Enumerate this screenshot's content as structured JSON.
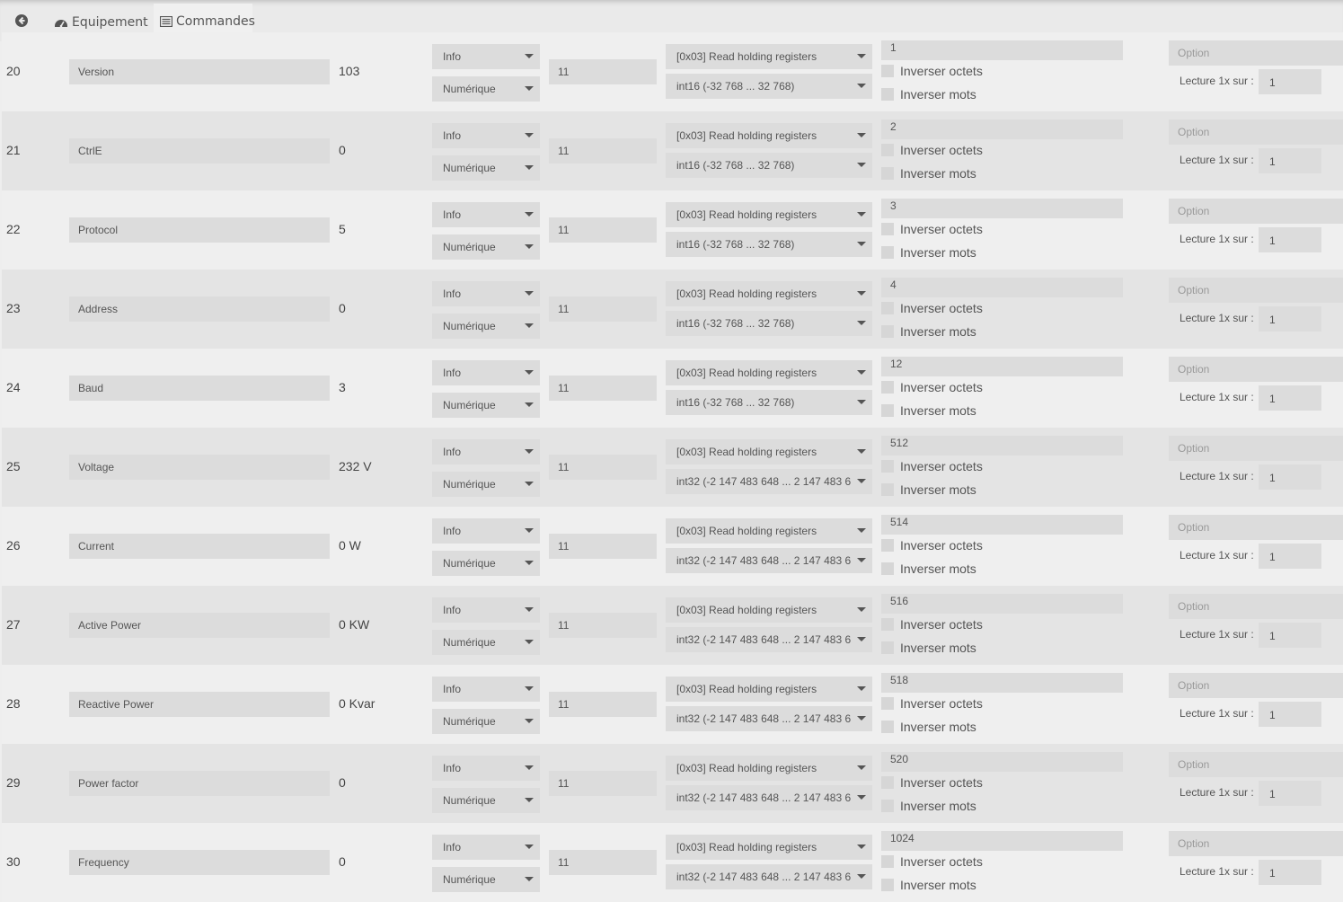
{
  "tabs": {
    "equipement": "Equipement",
    "commandes": "Commandes"
  },
  "common": {
    "type": "Info",
    "subtype": "Numérique",
    "slave": "11",
    "function": "[0x03] Read holding registers",
    "invert_bytes": "Inverser octets",
    "invert_words": "Inverser mots",
    "option_placeholder": "Option",
    "read_label": "Lecture 1x sur :",
    "read_value": "1"
  },
  "rows": [
    {
      "id": "20",
      "name": "Version",
      "value": "103",
      "format": "int16 (-32 768 ... 32 768)",
      "address": "1"
    },
    {
      "id": "21",
      "name": "CtrlE",
      "value": "0",
      "format": "int16 (-32 768 ... 32 768)",
      "address": "2"
    },
    {
      "id": "22",
      "name": "Protocol",
      "value": "5",
      "format": "int16 (-32 768 ... 32 768)",
      "address": "3"
    },
    {
      "id": "23",
      "name": "Address",
      "value": "0",
      "format": "int16 (-32 768 ... 32 768)",
      "address": "4"
    },
    {
      "id": "24",
      "name": "Baud",
      "value": "3",
      "format": "int16 (-32 768 ... 32 768)",
      "address": "12"
    },
    {
      "id": "25",
      "name": "Voltage",
      "value": "232 V",
      "format": "int32 (-2 147 483 648 ... 2 147 483 6",
      "address": "512"
    },
    {
      "id": "26",
      "name": "Current",
      "value": "0 W",
      "format": "int32 (-2 147 483 648 ... 2 147 483 6",
      "address": "514"
    },
    {
      "id": "27",
      "name": "Active Power",
      "value": "0 KW",
      "format": "int32 (-2 147 483 648 ... 2 147 483 6",
      "address": "516"
    },
    {
      "id": "28",
      "name": "Reactive Power",
      "value": "0 Kvar",
      "format": "int32 (-2 147 483 648 ... 2 147 483 6",
      "address": "518"
    },
    {
      "id": "29",
      "name": "Power factor",
      "value": "0",
      "format": "int32 (-2 147 483 648 ... 2 147 483 6",
      "address": "520"
    },
    {
      "id": "30",
      "name": "Frequency",
      "value": "0",
      "format": "int32 (-2 147 483 648 ... 2 147 483 6",
      "address": "1024"
    }
  ]
}
